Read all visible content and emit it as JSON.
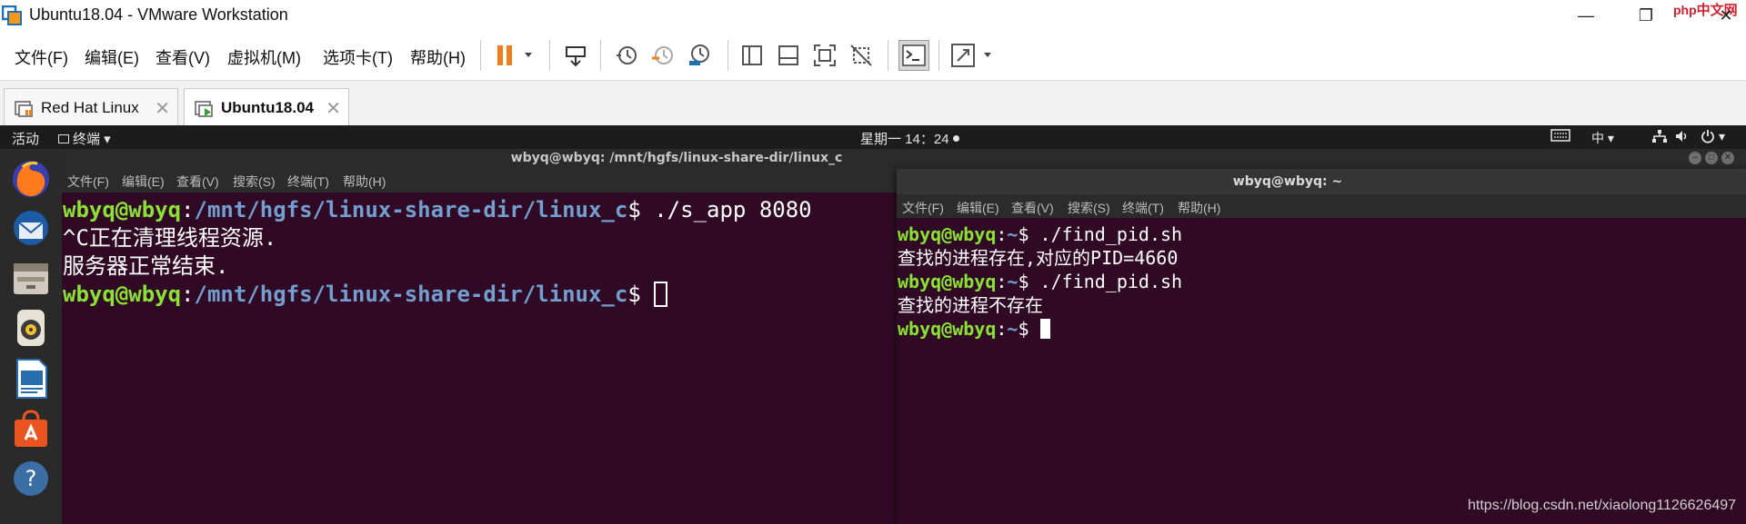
{
  "window": {
    "title": "Ubuntu18.04 - VMware Workstation",
    "watermark_logo": "php",
    "watermark_logo_cn": "中文网",
    "minimize_glyph": "—",
    "restore_glyph": "❐",
    "close_glyph": "✕"
  },
  "menu": {
    "file": "文件(F)",
    "edit": "编辑(E)",
    "view": "查看(V)",
    "vm": "虚拟机(M)",
    "tabs": "选项卡(T)",
    "help": "帮助(H)"
  },
  "tabs": [
    {
      "label": "Red Hat Linux",
      "active": false
    },
    {
      "label": "Ubuntu18.04",
      "active": true
    }
  ],
  "guest_topbar": {
    "activities": "活动",
    "app_menu": "终端 ▾",
    "clock": "星期一 14：24",
    "input_method": "中 ▾",
    "network_icon": "network-icon",
    "volume_icon": "volume-icon",
    "power_icon": "power-icon"
  },
  "dock": {
    "icons": [
      "firefox-icon",
      "thunderbird-icon",
      "files-icon",
      "rhythmbox-icon",
      "libreoffice-writer-icon",
      "software-center-icon",
      "help-icon"
    ]
  },
  "terminal1": {
    "title": "wbyq@wbyq: /mnt/hgfs/linux-share-dir/linux_c",
    "menu": [
      "文件(F)",
      "编辑(E)",
      "查看(V)",
      "搜索(S)",
      "终端(T)",
      "帮助(H)"
    ],
    "lines": [
      {
        "user": "wbyq@wbyq",
        "path": "/mnt/hgfs/linux-share-dir/linux_c",
        "cmd": " ./s_app 8080"
      },
      {
        "text": "^C正在清理线程资源."
      },
      {
        "text": "服务器正常结束."
      },
      {
        "user": "wbyq@wbyq",
        "path": "/mnt/hgfs/linux-share-dir/linux_c",
        "cmd": " "
      }
    ]
  },
  "terminal2": {
    "title": "wbyq@wbyq: ~",
    "menu": [
      "文件(F)",
      "编辑(E)",
      "查看(V)",
      "搜索(S)",
      "终端(T)",
      "帮助(H)"
    ],
    "lines": [
      {
        "user": "wbyq@wbyq",
        "path": "~",
        "cmd": " ./find_pid.sh"
      },
      {
        "text": "查找的进程存在,对应的PID=4660"
      },
      {
        "user": "wbyq@wbyq",
        "path": "~",
        "cmd": " ./find_pid.sh"
      },
      {
        "text": "查找的进程不存在"
      },
      {
        "user": "wbyq@wbyq",
        "path": "~",
        "cmd": " "
      }
    ]
  },
  "csdn_watermark": "https://blog.csdn.net/xiaolong1126626497",
  "colors": {
    "terminal_bg": "#300a24",
    "prompt_user": "#8ae234",
    "prompt_path": "#729fcf",
    "pause_orange": "#f07f1b"
  }
}
